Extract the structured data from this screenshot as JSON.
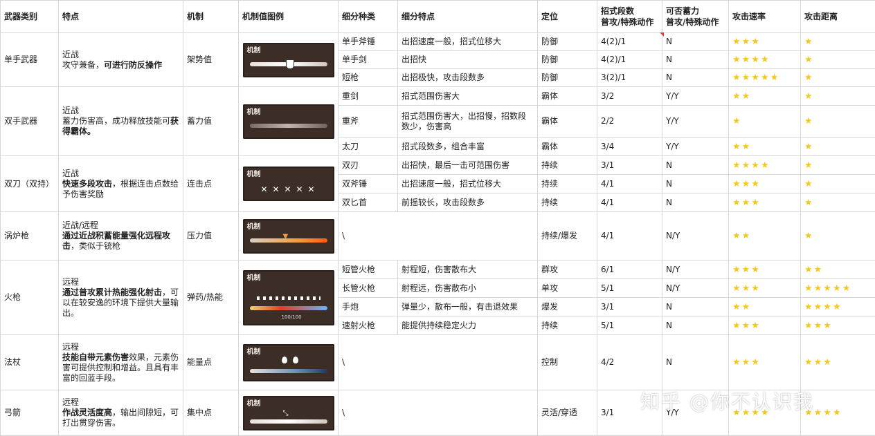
{
  "headers": {
    "weapon_type": "武器类别",
    "feature": "特点",
    "mechanic": "机制",
    "mechanic_example": "机制值图例",
    "subtype": "细分种类",
    "subtype_feature": "细分特点",
    "role": "定位",
    "combo_line1": "招式段数",
    "combo_line2": "普攻/特殊动作",
    "charge_line1": "可否蓄力",
    "charge_line2": "普攻/特殊动作",
    "attack_speed": "攻击速率",
    "attack_range": "攻击距离"
  },
  "panel_label": "机制",
  "ammo_readout": "100/100",
  "categories": [
    {
      "name": "单手武器",
      "feature_plain1": "近战",
      "feature_plain2": "攻守兼备，",
      "feature_bold": "可进行防反操作",
      "feature_tail": "",
      "mechanic": "架势值",
      "rows": [
        {
          "subtype": "单手斧锤",
          "detail": "出招速度一般，招式位移大",
          "role": "防御",
          "combo": "4(2)/1",
          "charge": "N",
          "speed": 3,
          "range": 1
        },
        {
          "subtype": "单手剑",
          "detail": "出招快",
          "role": "防御",
          "combo": "4(2)/1",
          "charge": "N",
          "speed": 4,
          "range": 1
        },
        {
          "subtype": "短枪",
          "detail": "出招极快，攻击段数多",
          "role": "防御",
          "combo": "3(2)/1",
          "charge": "N",
          "speed": 5,
          "range": 1
        }
      ]
    },
    {
      "name": "双手武器",
      "feature_plain1": "近战",
      "feature_plain2": "蓄力伤害高，成功释放技能可",
      "feature_bold": "获得霸体。",
      "feature_tail": "",
      "mechanic": "蓄力值",
      "rows": [
        {
          "subtype": "重剑",
          "detail": "招式范围伤害大",
          "role": "霸体",
          "combo": "3/2",
          "charge": "Y/Y",
          "speed": 2,
          "range": 1
        },
        {
          "subtype": "重斧",
          "detail": "招式范围伤害大，出招慢，招数段数少，伤害高",
          "role": "霸体",
          "combo": "2/2",
          "charge": "Y/Y",
          "speed": 1,
          "range": 1
        },
        {
          "subtype": "太刀",
          "detail": "招式段数多，组合丰富",
          "role": "霸体",
          "combo": "3/4",
          "charge": "Y/Y",
          "speed": 2,
          "range": 1
        }
      ]
    },
    {
      "name": "双刀（双持）",
      "feature_plain1": "近战",
      "feature_plain2": "",
      "feature_bold": "快速多段攻击",
      "feature_tail": "，根据连击点数给予伤害奖励",
      "mechanic": "连击点",
      "rows": [
        {
          "subtype": "双刃",
          "detail": "出招快，最后一击可范围伤害",
          "role": "持续",
          "combo": "3/1",
          "charge": "N",
          "speed": 4,
          "range": 1
        },
        {
          "subtype": "双斧锤",
          "detail": "出招速度一般，招式位移大",
          "role": "持续",
          "combo": "4/1",
          "charge": "N",
          "speed": 3,
          "range": 1
        },
        {
          "subtype": "双匕首",
          "detail": "前摇较长，攻击段数多",
          "role": "持续",
          "combo": "4/1",
          "charge": "N",
          "speed": 3,
          "range": 1
        }
      ]
    },
    {
      "name": "涡炉枪",
      "feature_plain1": "近战/远程",
      "feature_plain2": "",
      "feature_bold": "通过近战积蓄能量强化远程攻击",
      "feature_tail": "，类似于铳枪",
      "mechanic": "压力值",
      "rows": [
        {
          "subtype": "\\",
          "detail": "",
          "role": "持续/爆发",
          "combo": "4/1",
          "charge": "N/Y",
          "speed": 2,
          "range": 1
        }
      ]
    },
    {
      "name": "火枪",
      "feature_plain1": "远程",
      "feature_plain2": "",
      "feature_bold": "通过普攻累计热能强化射击",
      "feature_tail": "，可以在较安逸的环境下提供大量输出。",
      "mechanic": "弹药/热能",
      "rows": [
        {
          "subtype": "短管火枪",
          "detail": "射程短，伤害散布大",
          "role": "群攻",
          "combo": "6/1",
          "charge": "N/Y",
          "speed": 3,
          "range": 2
        },
        {
          "subtype": "长管火枪",
          "detail": "射程远，伤害散布小",
          "role": "单攻",
          "combo": "5/1",
          "charge": "N/Y",
          "speed": 3,
          "range": 5
        },
        {
          "subtype": "手炮",
          "detail": "弹量少，散布一般，有击退效果",
          "role": "爆发",
          "combo": "3/1",
          "charge": "N",
          "speed": 2,
          "range": 4
        },
        {
          "subtype": "速射火枪",
          "detail": "能提供持续稳定火力",
          "role": "持续",
          "combo": "5/1",
          "charge": "N",
          "speed": 3,
          "range": 3
        }
      ]
    },
    {
      "name": "法杖",
      "feature_plain1": "远程",
      "feature_plain2": "",
      "feature_bold": "技能自带元素伤害",
      "feature_tail": "效果，元素伤害可提供控制和增益。且具有丰富的回蓝手段。",
      "mechanic": "能量点",
      "rows": [
        {
          "subtype": "\\",
          "detail": "",
          "role": "控制",
          "combo": "4/2",
          "charge": "N",
          "speed": 3,
          "range": 3
        }
      ]
    },
    {
      "name": "弓箭",
      "feature_plain1": "远程",
      "feature_plain2": "",
      "feature_bold": "作战灵活度高",
      "feature_tail": "，输出间隙短，可打出贯穿伤害。",
      "mechanic": "集中点",
      "rows": [
        {
          "subtype": "\\",
          "detail": "",
          "role": "灵活/穿透",
          "combo": "3/1",
          "charge": "Y/Y",
          "speed": 4,
          "range": 4
        }
      ]
    }
  ],
  "watermark": "知乎 @你不认识我",
  "colors": {
    "star": "#f3c81f",
    "panel_bg": "#3c2d27",
    "comment_marker": "#e0403c"
  }
}
